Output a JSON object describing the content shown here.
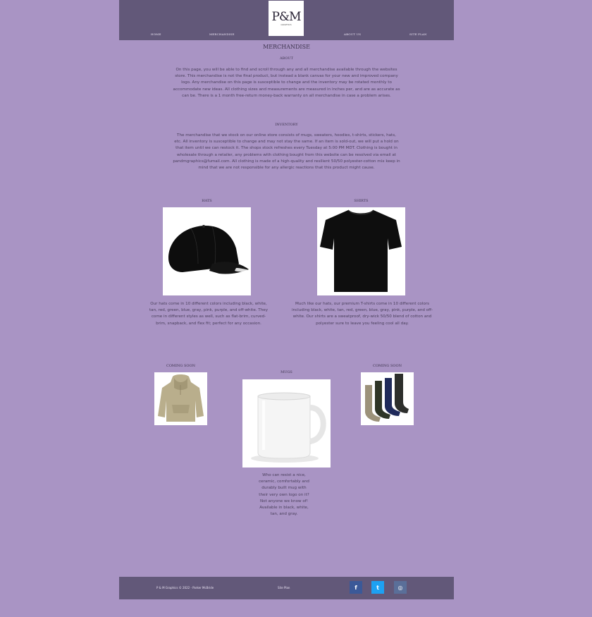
{
  "brand": {
    "logo_text": "P&M",
    "logo_sub": "GRAPHICS"
  },
  "nav": {
    "home": "Home",
    "merchandise": "Merchandise",
    "about": "About Us",
    "site_plan": "Site Plan"
  },
  "page_title": "Merchandise",
  "about": {
    "heading": "About",
    "text": "On this page, you will be able to find and scroll through any and all merchandise available through the websites store. This merchandise is not the final product, but instead a blank canvas for your new and improved company logo. Any merchandise on this page is susceptible to change and the inventory may be rotated monthly to accommodate new ideas. All clothing sizes and measurements are measured in inches per, and are as accurate as can be. There is a 1 month free-return money-back warranty on all merchandise in case a problem arises."
  },
  "inventory": {
    "heading": "Inventory",
    "text": "The merchandise that we stock on our online store consists of mugs, sweaters, hoodies, t-shirts, stickers, hats, etc. All inventory is susceptible to change and may not stay the same. If an item is sold-out, we will put a hold on that item until we can restock it. The shops stock refreshes every Tuesday at 5:00 PM MDT. Clothing is bought in wholesale through a retailer, any problems with clothing bought from this website can be resolved via email at pandmgraphics@fumail.com. All clothing is made of a high-quality and resilient 50/50 polyester-cotton mix keep in mind that we are not responsible for any allergic reactions that this product might cause."
  },
  "products": {
    "hats": {
      "heading": "Hats",
      "text": "Our hats come in 10 different colors including black, white, tan, red, green, blue, gray, pink, purple, and off-white. They come in different styles as well, such as flat-brim, curved-brim, snapback, and flex fit; perfect for any occasion."
    },
    "shirts": {
      "heading": "Shirts",
      "text": "Much like our hats, our premium T-shirts come in 10 different colors including black, white, tan, red, green, blue, gray, pink, purple, and off-white. Our shirts are a sweatproof, dry-wick 50/50 blend of cotton and polyester sure to leave you feeling cool all day."
    },
    "hoodie": {
      "heading": "Coming Soon"
    },
    "mugs": {
      "heading": "Mugs",
      "text": "Who can resist a nice, ceramic, comfortably and durably built mug with their very own logo on it? Not anyone we know of! Available in black, white, tan, and gray."
    },
    "socks": {
      "heading": "Coming Soon"
    }
  },
  "footer": {
    "copyright": "P & M Graphics © 2022 - Parker McBride",
    "site_plan": "Site Plan",
    "social": [
      {
        "icon": "facebook-icon",
        "glyph": "f",
        "color": "#3b5998"
      },
      {
        "icon": "twitter-icon",
        "glyph": "t",
        "color": "#1da1f2"
      },
      {
        "icon": "instagram-icon",
        "glyph": "◎",
        "color": "#5a6f99"
      }
    ]
  },
  "colors": {
    "background": "#a994c4",
    "header_footer": "#625879"
  }
}
